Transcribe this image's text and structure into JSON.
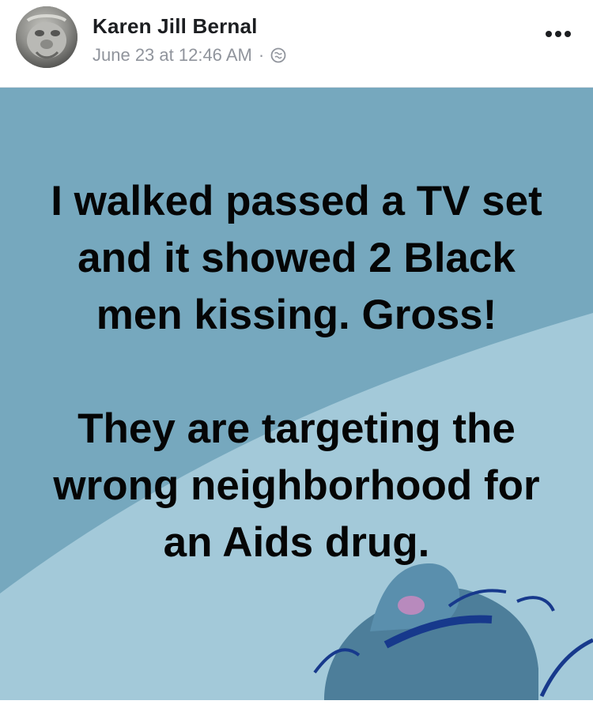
{
  "post": {
    "author": "Karen Jill Bernal",
    "date": "June 23 at 12:46 AM",
    "separator": "·",
    "privacy_icon": "globe-icon",
    "more_icon": "ellipsis-icon",
    "avatar_icon": "profile-photo-avatar"
  },
  "content": {
    "text_line_1": "I walked passed a TV set and it showed 2 Black men kissing. Gross!",
    "text_line_2": "They are targeting the wrong neighborhood for an Aids drug."
  },
  "colors": {
    "background_primary": "#76a8be",
    "background_secondary": "#a3c9d9",
    "text": "#050505",
    "author_text": "#1c1e21",
    "meta_text": "#90949c"
  }
}
